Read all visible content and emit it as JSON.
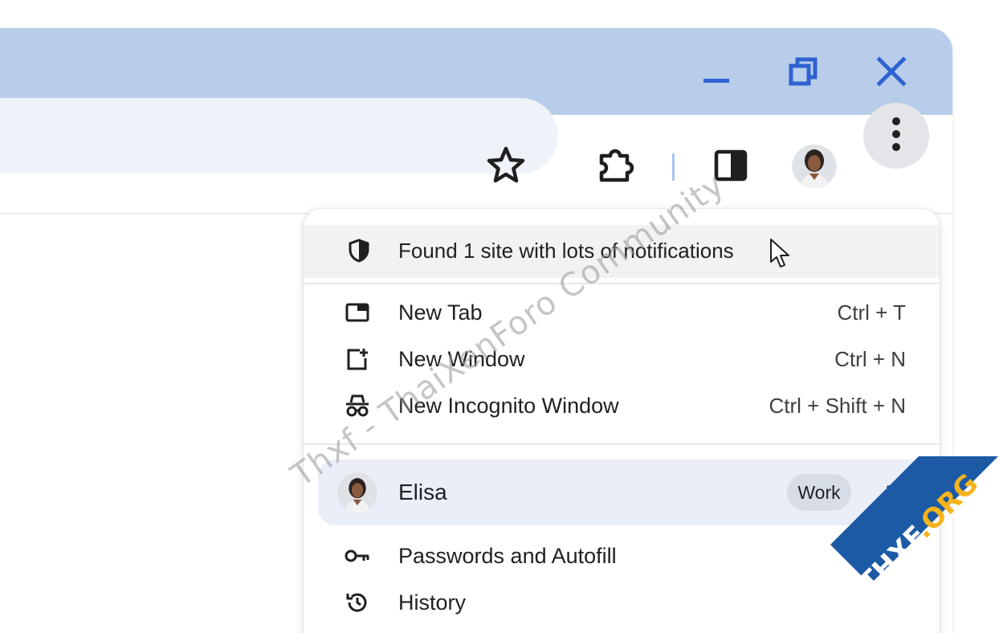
{
  "window_controls": {
    "minimize_icon": "minimize-icon",
    "restore_icon": "restore-icon",
    "close_icon": "close-icon",
    "color": "#2f62d0"
  },
  "toolbar": {
    "bookmark_icon": "star-outline-icon",
    "extensions_icon": "puzzle-icon",
    "side_panel_icon": "side-panel-icon",
    "profile_icon": "avatar",
    "menu_icon": "kebab-icon"
  },
  "menu": {
    "notification": {
      "icon": "shield-icon",
      "label": "Found 1 site with lots of notifications"
    },
    "items": [
      {
        "icon": "new-tab-icon",
        "label": "New Tab",
        "shortcut": "Ctrl + T"
      },
      {
        "icon": "new-window-icon",
        "label": "New Window",
        "shortcut": "Ctrl + N"
      },
      {
        "icon": "incognito-icon",
        "label": "New Incognito Window",
        "shortcut": "Ctrl + Shift + N"
      }
    ],
    "profile": {
      "name": "Elisa",
      "badge": "Work"
    },
    "items2": [
      {
        "icon": "key-icon",
        "label": "Passwords and Autofill"
      },
      {
        "icon": "history-icon",
        "label": "History"
      }
    ]
  },
  "watermark": {
    "text": "Thxf - ThaiXenForo Community",
    "corner_prefix": "THXF",
    "corner_suffix": ".ORG"
  },
  "colors": {
    "titlebar": "#b8cdea",
    "omnibox": "#eef2f9",
    "profile_row": "#e9eef8",
    "accent": "#2f62d0"
  }
}
